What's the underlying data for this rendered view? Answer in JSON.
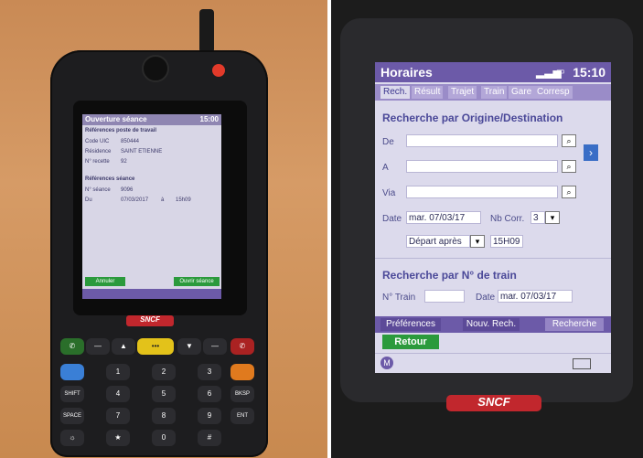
{
  "left_device": {
    "screen_title": "Ouverture séance",
    "clock": "15:00",
    "section1_title": "Références poste de travail",
    "rows1": [
      {
        "label": "Code UIC",
        "value": "850444"
      },
      {
        "label": "Résidence",
        "value": "SAINT ETIENNE"
      },
      {
        "label": "N° recette",
        "value": "92"
      }
    ],
    "section2_title": "Références séance",
    "rows2": [
      {
        "label": "N° séance",
        "value": "9096"
      },
      {
        "label": "Du",
        "value": "07/03/2017"
      }
    ],
    "du_a": "à",
    "du_time": "15h09",
    "cancel_label": "Annuler",
    "open_label": "Ouvrir séance",
    "brand": "SNCF",
    "keys": {
      "shift": "SHIFT",
      "space": "SPACE",
      "bksp": "BKSP",
      "ent": "ENT",
      "k1": "1",
      "k2": "2",
      "k3": "3",
      "k4": "4",
      "k5": "5",
      "k6": "6",
      "k7": "7",
      "k8": "8",
      "k9": "9",
      "k0": "0"
    }
  },
  "right_device": {
    "title": "Horaires",
    "clock": "15:10",
    "tabs": [
      "Rech.",
      "Résult",
      "Trajet",
      "Train",
      "Gare",
      "Corresp"
    ],
    "section1_title": "Recherche par Origine/Destination",
    "de_label": "De",
    "a_label": "A",
    "via_label": "Via",
    "date_label": "Date",
    "date_value": "mar. 07/03/17",
    "nbcorr_label": "Nb Corr.",
    "nbcorr_value": "3",
    "depart_value": "Départ après",
    "time_value": "15H09",
    "section2_title": "Recherche par N° de train",
    "ntrain_label": "N° Train",
    "date2_label": "Date",
    "date2_value": "mar. 07/03/17",
    "buttons": {
      "preferences": "Préférences",
      "nouv": "Nouv. Rech.",
      "recherche": "Recherche"
    },
    "retour_label": "Retour",
    "brand": "SNCF"
  },
  "colors": {
    "purple": "#6c5aa8",
    "green": "#2b9a3c",
    "sncf_red": "#c1272d"
  }
}
